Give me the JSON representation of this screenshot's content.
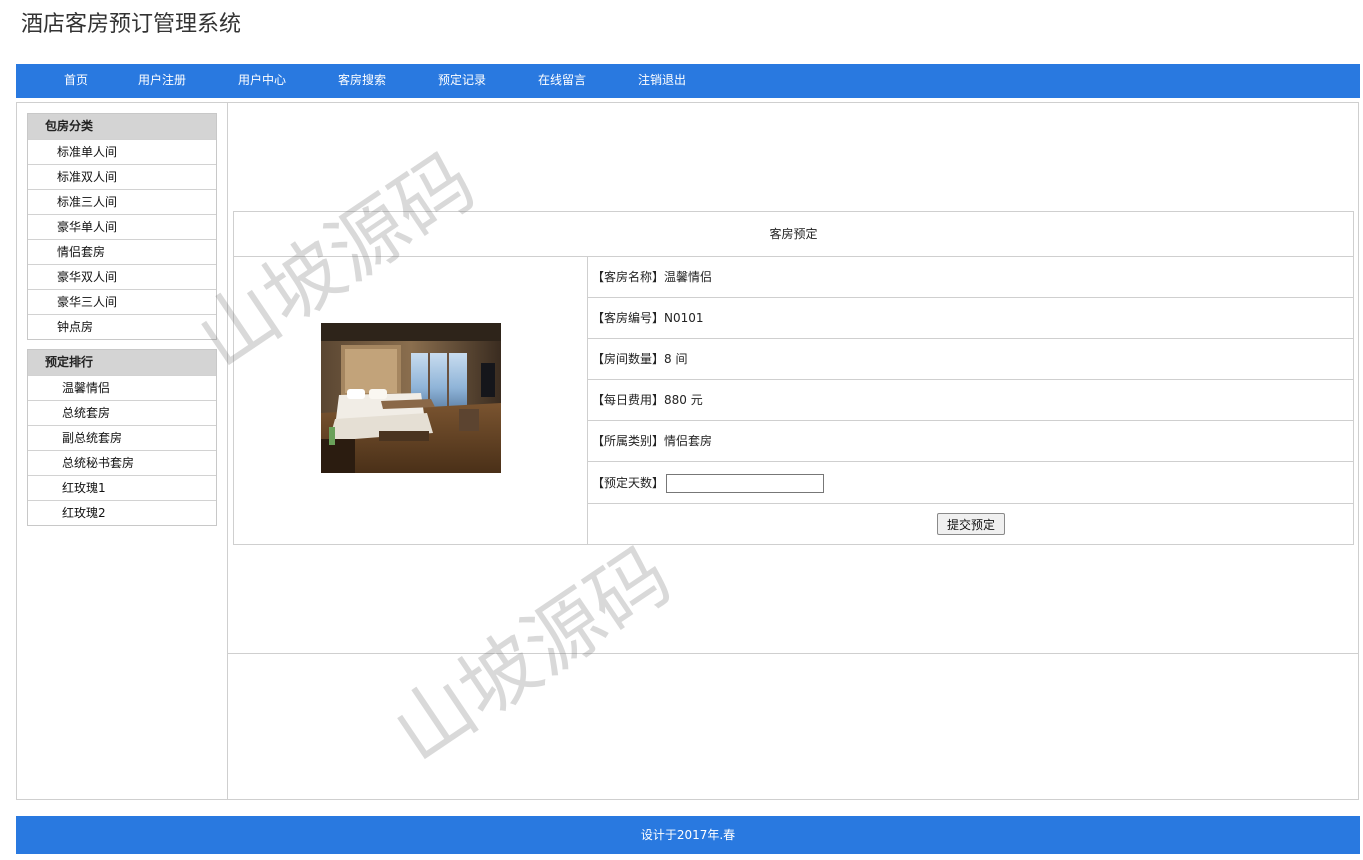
{
  "site": {
    "title": "酒店客房预订管理系统"
  },
  "nav": {
    "items": [
      "首页",
      "用户注册",
      "用户中心",
      "客房搜索",
      "预定记录",
      "在线留言",
      "注销退出"
    ]
  },
  "sidebar": {
    "categories": {
      "heading": "包房分类",
      "items": [
        "标准单人间",
        "标准双人间",
        "标准三人间",
        "豪华单人间",
        "情侣套房",
        "豪华双人间",
        "豪华三人间",
        "钟点房"
      ]
    },
    "ranking": {
      "heading": "预定排行",
      "items": [
        "温馨情侣",
        "总统套房",
        "副总统套房",
        "总统秘书套房",
        "红玫瑰1",
        "红玫瑰2"
      ]
    }
  },
  "booking": {
    "title": "客房预定",
    "image_icon": "hotel-room-photo",
    "rows": [
      {
        "label": "【客房名称】",
        "value": "温馨情侣"
      },
      {
        "label": "【客房编号】",
        "value": "N0101"
      },
      {
        "label": "【房间数量】",
        "value": "8 间"
      },
      {
        "label": "【每日费用】",
        "value": "880 元"
      },
      {
        "label": "【所属类别】",
        "value": "情侣套房"
      }
    ],
    "days_label": "【预定天数】",
    "days_value": "",
    "submit_label": "提交预定"
  },
  "footer": {
    "text": "设计于2017年.春"
  },
  "watermark": {
    "text": "山坡源码"
  },
  "colors": {
    "accent": "#2979e0",
    "sidebar_head": "#d4d4d4",
    "border": "#cfcfcf"
  }
}
